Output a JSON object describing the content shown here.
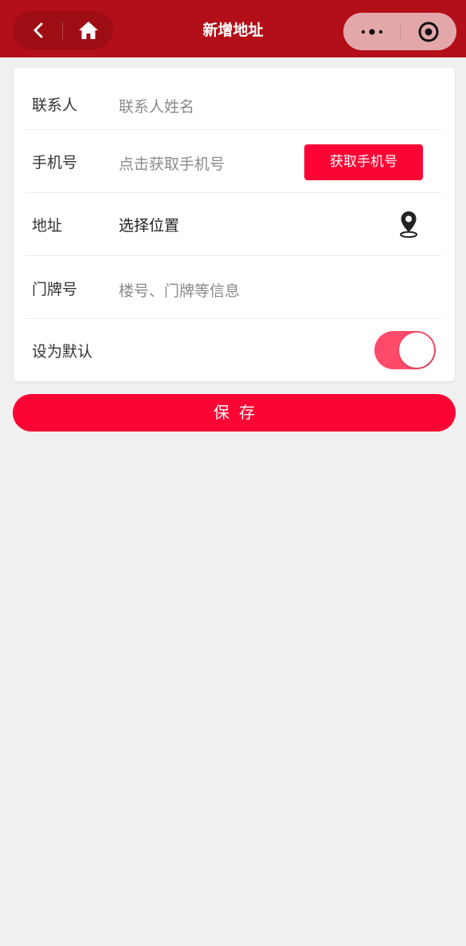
{
  "navbar": {
    "title": "新增地址",
    "back_icon": "chevron-left-icon",
    "home_icon": "home-icon",
    "more_icon": "more-dots-icon",
    "close_icon": "target-circle-icon",
    "background_color": "#b20f18"
  },
  "form": {
    "contact": {
      "label": "联系人",
      "placeholder": "联系人姓名"
    },
    "phone": {
      "label": "手机号",
      "placeholder": "点击获取手机号",
      "button_label": "获取手机号"
    },
    "address": {
      "label": "地址",
      "value": "选择位置",
      "icon": "location-pin-icon"
    },
    "door": {
      "label": "门牌号",
      "placeholder": "楼号、门牌等信息"
    },
    "default": {
      "label": "设为默认",
      "enabled": true
    }
  },
  "save_label": "保存",
  "colors": {
    "accent": "#fc0535",
    "toggle_on": "#ff4a6a",
    "page_background": "#f0f0f0"
  }
}
